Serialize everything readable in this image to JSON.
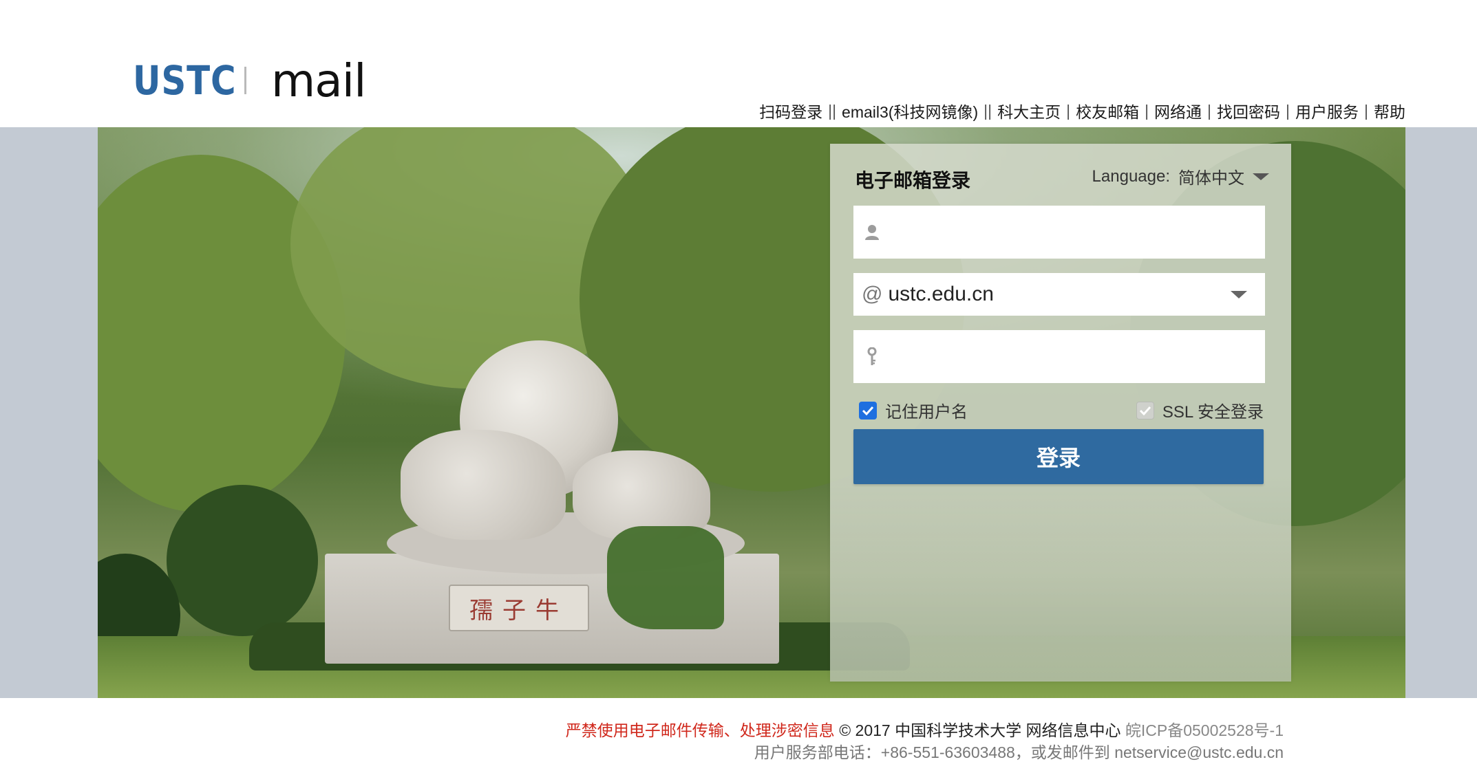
{
  "logo": {
    "left_text": "USTC",
    "right_text": "mail",
    "brand_color": "#2d67a1"
  },
  "topnav": {
    "items": [
      "扫码登录",
      "email3(科技网镜像)",
      "科大主页",
      "校友邮箱",
      "网络通",
      "找回密码",
      "用户服务",
      "帮助"
    ],
    "separators": [
      "||",
      "||",
      "|",
      "|",
      "|",
      "|",
      "|"
    ]
  },
  "banner": {
    "plaque_text": "孺子牛"
  },
  "login": {
    "title": "电子邮箱登录",
    "language_label": "Language:",
    "language_value": "简体中文",
    "username_value": "",
    "username_icon": "user-icon",
    "domain_prefix": "@",
    "domain_value": "ustc.edu.cn",
    "password_value": "",
    "password_icon": "key-icon",
    "remember_label": "记住用户名",
    "remember_checked": true,
    "ssl_label": "SSL 安全登录",
    "ssl_checked": true,
    "submit_label": "登录",
    "button_color": "#2f6aa0"
  },
  "footer": {
    "warning": "严禁使用电子邮件传输、处理涉密信息",
    "copyright": "© 2017 中国科学技术大学 网络信息中心",
    "icp": "皖ICP备05002528号-1",
    "service": "用户服务部电话：+86-551-63603488，或发邮件到 netservice@ustc.edu.cn",
    "warning_color": "#d0281c"
  }
}
